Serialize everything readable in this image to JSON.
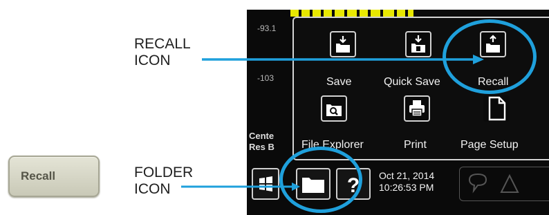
{
  "hardware_key": {
    "label": "Recall"
  },
  "callouts": {
    "recall_icon": {
      "line1": "RECALL",
      "line2": "ICON"
    },
    "folder_icon": {
      "line1": "FOLDER",
      "line2": "ICON"
    }
  },
  "screen": {
    "axis_values": [
      "-93.1",
      "-103"
    ],
    "status_left": [
      "Cente",
      "Res B"
    ]
  },
  "popup_menu": {
    "items": [
      {
        "label": "Save",
        "icon": "save-icon"
      },
      {
        "label": "Quick Save",
        "icon": "quick-save-icon"
      },
      {
        "label": "Recall",
        "icon": "recall-icon"
      },
      {
        "label": "File Explorer",
        "icon": "file-explorer-icon"
      },
      {
        "label": "Print",
        "icon": "print-icon"
      },
      {
        "label": "Page Setup",
        "icon": "page-setup-icon"
      }
    ]
  },
  "bottom_bar": {
    "date": "Oct 21, 2014",
    "time": "10:26:53 PM",
    "buttons": [
      "windows-icon",
      "folder-icon",
      "help-icon"
    ]
  },
  "colors": {
    "highlight": "#1fa0dc",
    "screen_bg": "#0a0a0a",
    "trace_yellow": "#e8e800"
  }
}
